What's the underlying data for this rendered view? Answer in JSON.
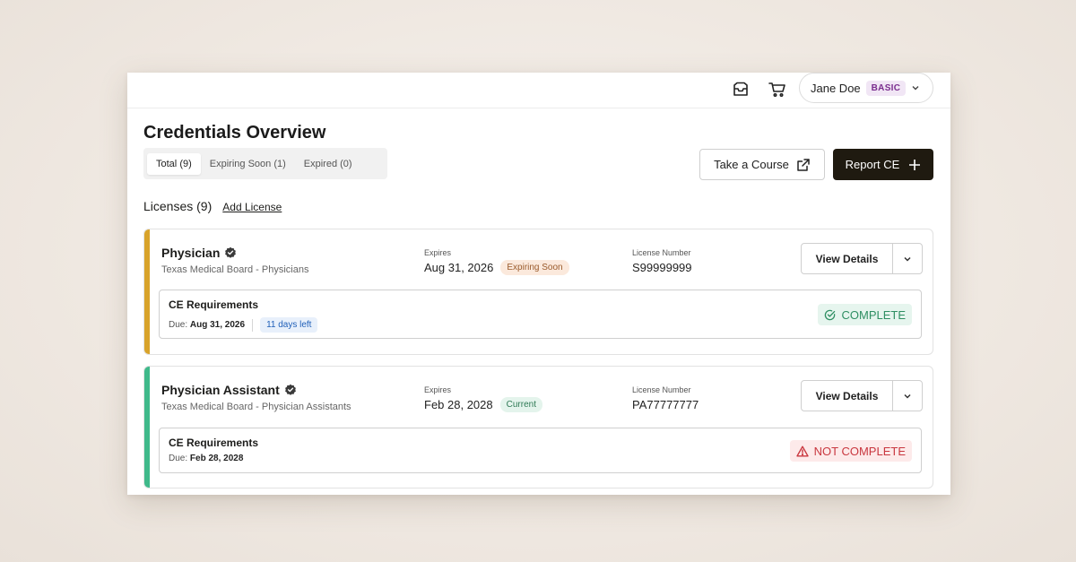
{
  "header": {
    "user_name": "Jane Doe",
    "plan_badge": "BASIC"
  },
  "page": {
    "title": "Credentials Overview",
    "tabs": [
      {
        "label": "Total",
        "count": "(9)"
      },
      {
        "label": "Expiring Soon",
        "count": "(1)"
      },
      {
        "label": "Expired",
        "count": "(0)"
      }
    ],
    "take_course_label": "Take a Course",
    "report_ce_label": "Report CE",
    "licenses_heading": "Licenses (9)",
    "add_license_label": "Add License"
  },
  "licenses": [
    {
      "name": "Physician",
      "board": "Texas Medical Board - Physicians",
      "expires_label": "Expires",
      "expires": "Aug 31, 2026",
      "status": "Expiring Soon",
      "license_number_label": "License Number",
      "license_number": "S99999999",
      "view_details_label": "View Details",
      "ce_title": "CE Requirements",
      "ce_due_label": "Due:",
      "ce_due": "Aug 31, 2026",
      "ce_days_left": "11 days left",
      "ce_status": "COMPLETE",
      "accent": "#d8a32a"
    },
    {
      "name": "Physician Assistant",
      "board": "Texas Medical Board - Physician Assistants",
      "expires_label": "Expires",
      "expires": "Feb 28, 2028",
      "status": "Current",
      "license_number_label": "License Number",
      "license_number": "PA77777777",
      "view_details_label": "View Details",
      "ce_title": "CE Requirements",
      "ce_due_label": "Due:",
      "ce_due": "Feb 28, 2028",
      "ce_status": "NOT COMPLETE",
      "accent": "#3fb98a"
    }
  ],
  "colors": {
    "complete_text": "#2f8f63",
    "complete_bg": "#e6f5ee",
    "not_complete_text": "#c9373f",
    "not_complete_bg": "#fdeaea",
    "expiring_bg": "#fbe9dc",
    "expiring_text": "#9a5a2b",
    "current_bg": "#e4f4ec",
    "current_text": "#2f7a55"
  }
}
